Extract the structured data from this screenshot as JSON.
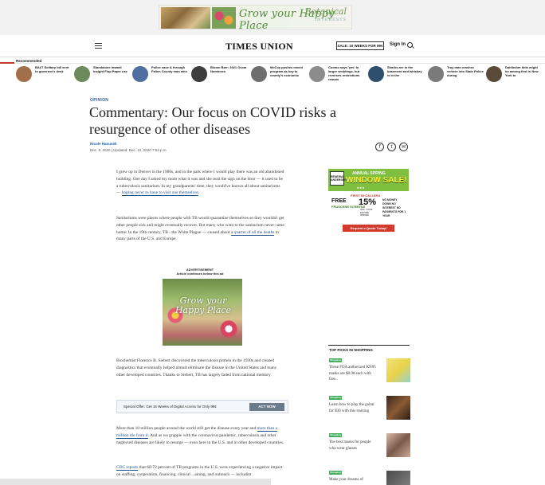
{
  "top_ad": {
    "headline": "Grow your Happy Place",
    "brand": "Botanical",
    "brand_sub": "INTERESTS"
  },
  "masthead": {
    "logo": "TIMES UNION",
    "sale_button": "SALE: 10 WEEKS FOR 99¢",
    "signin": "Sign In"
  },
  "recommended": {
    "label": "Recommended",
    "accent_color": "#c0392b",
    "items": [
      {
        "text": "BALT Solitary bill sent to governor's desk",
        "thumb_color": "#a1704a"
      },
      {
        "text": "Standalone Inward Insight Flop Paper use",
        "thumb_color": "#6d8a5c"
      },
      {
        "text": "Police case & through Fallen County man who",
        "thumb_color": "#4e6fa0"
      },
      {
        "text": "Bloom Barr: 2021 Oscar Nominees",
        "thumb_color": "#3d3d3d"
      },
      {
        "text": "McCoy pushes mixed program as key to county's economic",
        "thumb_color": "#6e6e6e"
      },
      {
        "text": "Cuomo says 'yes' to larger weddings, but reverses restrictions remain",
        "thumb_color": "#8c8c8c"
      },
      {
        "text": "Sharks are in the basement and whiskey is in the",
        "thumb_color": "#2e4f6e"
      },
      {
        "text": "Troy man crashes vehicle into State Police during",
        "thumb_color": "#7a7a7a"
      },
      {
        "text": "Dahlbohm bids might be among first in New York to",
        "thumb_color": "#5a4a3a"
      }
    ]
  },
  "article": {
    "section": "OPINION",
    "headline": "Commentary: Our focus on COVID risks a resurgence of other diseases",
    "byline": "Nicole Hanusek",
    "dateline": "Dec. 9, 2020 | Updated: Dec. 10, 2020 7:53 p.m.",
    "p1_a": "I grew up in Denver in the 1980s, and in the park where I would play there was an old abandoned building. One day I asked my mom what it was and she read the sign on the door — it used to be a tuberculosis sanitarium. In my grandparents' time, they would've known all about sanitariums — ",
    "p1_link": "hoping never to have to visit one themselves",
    "p1_b": ".",
    "p2_a": "Sanitariums were places where people with TB would quarantine themselves so they wouldn't get other people sick and might eventually recover. But many who went to the sanitarium never came home: In the 19th century, TB - the White Plague — caused about ",
    "p2_link": "a quarter of all the deaths",
    "p2_b": " in many parts of the U.S. and Europe.",
    "ad_label": "ADVERTISEMENT",
    "ad_sub": "Article continues below this ad",
    "mid_ad_text": "Grow your Happy Place",
    "p3": "Biochemist Florence B. Siebert discovered the tuberculosis protein in the 1930s and created diagnostics that eventually helped almost eliminate the disease in the United States and many other developed countries. Thanks to Siebert, TB has largely faded from national memory.",
    "offer_text": "Special Offer: Get 16 Weeks of Digital Access for Only 99¢",
    "offer_button": "ACT NOW",
    "p4_a": "More than 10 million people around the world still get the disease every year and ",
    "p4_link": "more than a million die from it",
    "p4_b": ". And as we grapple with the coronavirus pandemic, tuberculosis and other neglected diseases are likely to resurge — even here in the U.S. and in other developed countries.",
    "p5_link": "CDC reports",
    "p5_b": " that 60-72 percent of TB programs in the U.S. were experiencing a negative impact on staffing, cooperation, financing, clinical ...aining, and outreach — includint"
  },
  "window_ad": {
    "spring": "ANNUAL SPRING",
    "sale": "WINDOW SALE!",
    "first": "FIRST 50 CALLERS",
    "free": "FREE",
    "screens": "FRUSCENE SCREENS",
    "pct": "15%",
    "pct_sub": "OFF YOUR ENTIRE ORDER",
    "list": "NO MONEY DOWN NO INTEREST NO PAYMENTS FOR 1 YEAR",
    "cta": "Request a Quote Today!",
    "logo": "RENEWAL ANDERSEN"
  },
  "top_picks": {
    "title": "TOP PICKS IN SHOPPING",
    "items": [
      {
        "badge": "Shopping",
        "text": "These FDA authorized KN95 masks are $0.98 each with free..."
      },
      {
        "badge": "Shopping",
        "text": "Learn how to play the guitar for $30 with this training"
      },
      {
        "badge": "Shopping",
        "text": "The best masks for people who wear glasses"
      },
      {
        "badge": "Shopping",
        "text": "Make your dreams of"
      }
    ]
  }
}
